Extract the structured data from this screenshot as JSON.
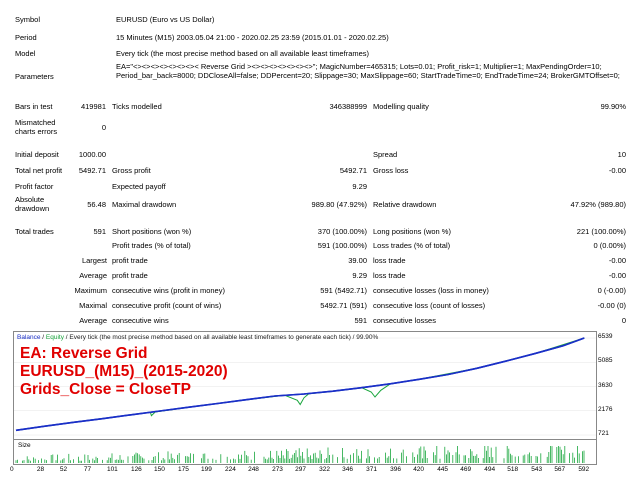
{
  "report": {
    "symbol_label": "Symbol",
    "symbol_value": "EURUSD (Euro vs US Dollar)",
    "period_label": "Period",
    "period_value": "15 Minutes (M15) 2003.05.04 21:00 - 2020.02.25 23:59 (2015.01.01 - 2020.02.25)",
    "model_label": "Model",
    "model_value": "Every tick (the most precise method based on all available least timeframes)",
    "parameters_label": "Parameters",
    "parameters_value": "EA=\"<><><><><><><>< Reverse Grid ><><><><><><><>\"; MagicNumber=465315; Lots=0.01; Profit_risk=1; Multiplier=1; MaxPendingOrder=10; Period_bar_back=8000; DDCloseAll=false; DDPercent=20; Slippage=30; MaxSlippage=60; StartTradeTime=0; EndTradeTime=24; BrokerGMTOffset=0;",
    "bars_label": "Bars in test",
    "bars_value": "419981",
    "ticks_label": "Ticks modelled",
    "ticks_value": "346388999",
    "quality_label": "Modelling quality",
    "quality_value": "99.90%",
    "mismatch_label": "Mismatched charts errors",
    "mismatch_value": "0",
    "deposit_label": "Initial deposit",
    "deposit_value": "1000.00",
    "spread_label": "Spread",
    "spread_value": "10",
    "netprofit_label": "Total net profit",
    "netprofit_value": "5492.71",
    "grossprofit_label": "Gross profit",
    "grossprofit_value": "5492.71",
    "grossloss_label": "Gross loss",
    "grossloss_value": "-0.00",
    "pf_label": "Profit factor",
    "expected_label": "Expected payoff",
    "expected_value": "9.29",
    "absdd_label": "Absolute drawdown",
    "absdd_value": "56.48",
    "maxdd_label": "Maximal drawdown",
    "maxdd_value": "989.80 (47.92%)",
    "reldd_label": "Relative drawdown",
    "reldd_value": "47.92% (989.80)",
    "trades_label": "Total trades",
    "trades_value": "591",
    "short_label": "Short positions (won %)",
    "short_value": "370 (100.00%)",
    "long_label": "Long positions (won %)",
    "long_value": "221 (100.00%)",
    "ptrades_label": "Profit trades (% of total)",
    "ptrades_value": "591 (100.00%)",
    "ltrades_label": "Loss trades (% of total)",
    "ltrades_value": "0 (0.00%)",
    "largest_label": "Largest",
    "largest_profit_label": "profit trade",
    "largest_profit_value": "39.00",
    "largest_loss_label": "loss trade",
    "largest_loss_value": "-0.00",
    "average_label": "Average",
    "average_profit_label": "profit trade",
    "average_profit_value": "9.29",
    "average_loss_label": "loss trade",
    "average_loss_value": "-0.00",
    "maximum_label": "Maximum",
    "max_wins_label": "consecutive wins (profit in money)",
    "max_wins_value": "591 (5492.71)",
    "max_losses_label": "consecutive losses (loss in money)",
    "max_losses_value": "0 (-0.00)",
    "maximal_label": "Maximal",
    "maximal_profit_label": "consecutive profit (count of wins)",
    "maximal_profit_value": "5492.71 (591)",
    "maximal_loss_label": "consecutive loss (count of losses)",
    "maximal_loss_value": "-0.00 (0)",
    "average2_label": "Average",
    "avg_wins_label": "consecutive wins",
    "avg_wins_value": "591",
    "avg_losses_label": "consecutive losses",
    "avg_losses_value": "0"
  },
  "chart_header": {
    "balance": "Balance",
    "sep": " / ",
    "equity": "Equity",
    "rest": " / Every tick (the most precise method based on all available least timeframes to generate each tick) / 99.90%"
  },
  "overlay": {
    "line1": "EA: Reverse Grid",
    "line2": "EURUSD_(M15)_(2015-2020)",
    "line3": "Grids_Close = CloseTP"
  },
  "size_label": "Size",
  "chart_data": {
    "type": "line",
    "x_ticks": [
      "0",
      "28",
      "52",
      "77",
      "101",
      "126",
      "150",
      "175",
      "199",
      "224",
      "248",
      "273",
      "297",
      "322",
      "346",
      "371",
      "396",
      "420",
      "445",
      "469",
      "494",
      "518",
      "543",
      "567",
      "592"
    ],
    "y_ticks": [
      "6539",
      "5085",
      "3630",
      "2176",
      "721"
    ],
    "ylim": [
      721,
      6539
    ],
    "xlim": [
      0,
      600
    ],
    "series": [
      {
        "name": "Balance",
        "color": "#1a2fc7",
        "x": [
          0,
          30,
          60,
          90,
          120,
          150,
          180,
          210,
          240,
          270,
          300,
          330,
          360,
          390,
          420,
          450,
          480,
          510,
          540,
          570,
          592
        ],
        "y": [
          1000,
          1250,
          1480,
          1700,
          1930,
          2160,
          2390,
          2610,
          2840,
          3060,
          3180,
          3350,
          3560,
          3790,
          4060,
          4350,
          4720,
          5150,
          5600,
          6080,
          6539
        ]
      },
      {
        "name": "Equity",
        "color": "#19a63d",
        "x": [
          0,
          60,
          120,
          140,
          141,
          145,
          180,
          240,
          280,
          293,
          296,
          300,
          305,
          330,
          360,
          370,
          374,
          380,
          390,
          420,
          480,
          540,
          592
        ],
        "y": [
          1000,
          1480,
          1930,
          2080,
          1880,
          2100,
          2390,
          2840,
          3100,
          2800,
          2550,
          2950,
          3200,
          3350,
          3560,
          3300,
          3000,
          3400,
          3790,
          4060,
          4720,
          5600,
          6539
        ]
      }
    ],
    "size_color": "#19a63d"
  }
}
